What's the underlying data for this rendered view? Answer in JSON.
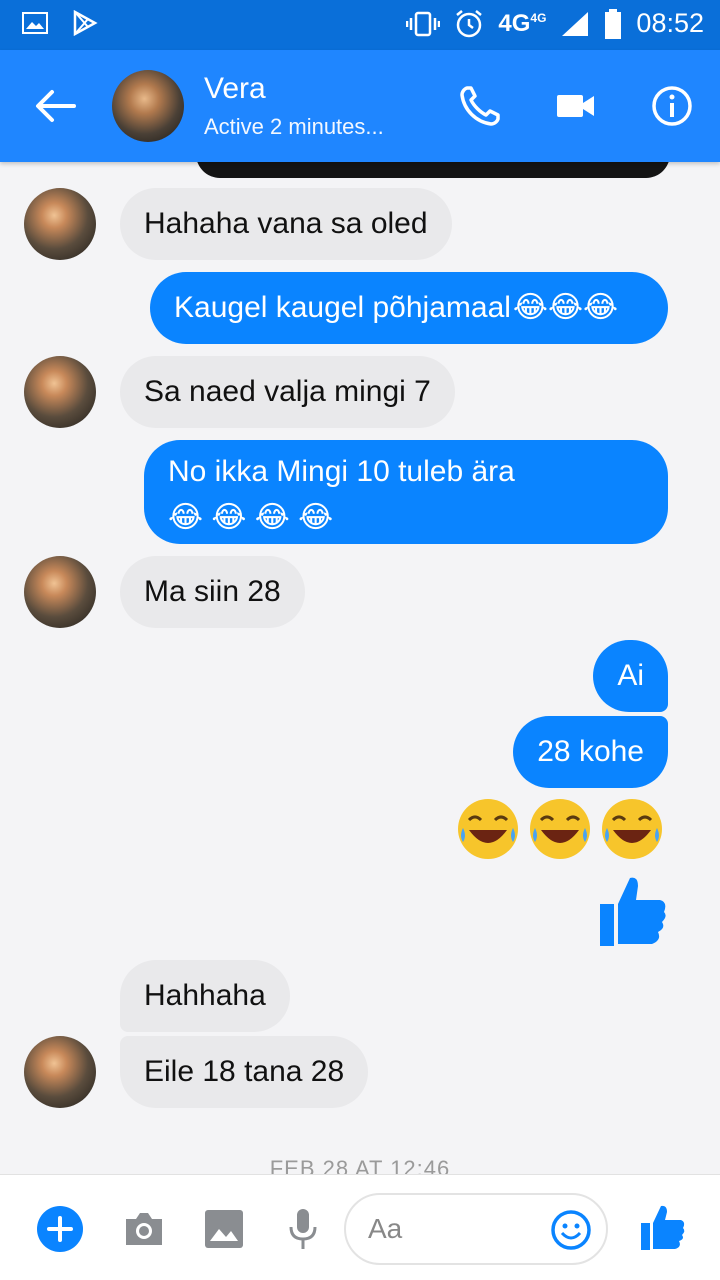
{
  "status_bar": {
    "time": "08:52",
    "network": "4G",
    "network_sup": "4G"
  },
  "header": {
    "name": "Vera",
    "status": "Active 2 minutes..."
  },
  "messages": {
    "m1": "Hahaha vana sa oled",
    "m2": "Kaugel kaugel põhjamaal",
    "m3": "Sa naed valja mingi 7",
    "m4": "No ikka Mingi 10 tuleb ära",
    "m5": "Ma siin 28",
    "m6": "Ai",
    "m7": "28 kohe",
    "m8": "Hahhaha",
    "m9": "Eile 18 tana 28"
  },
  "timestamp": "FEB 28 AT 12:46",
  "composer": {
    "placeholder": "Aa"
  },
  "colors": {
    "header": "#1f86ff",
    "statusbar": "#0a6fd9",
    "outgoing": "#0a84ff",
    "incoming": "#e9e9eb"
  }
}
